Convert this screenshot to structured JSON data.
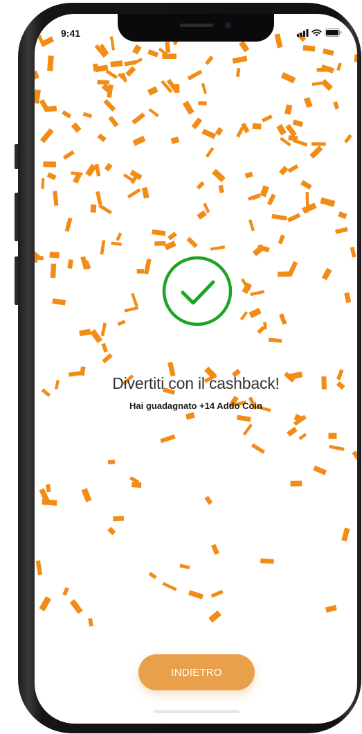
{
  "status_bar": {
    "time": "9:41",
    "icons": [
      "signal-icon",
      "wifi-icon",
      "battery-icon"
    ]
  },
  "success": {
    "icon": "checkmark-circle-icon",
    "title": "Divertiti con il cashback!",
    "subtitle": "Hai guadagnato +14 Addo Coin"
  },
  "actions": {
    "back_label": "INDIETRO"
  },
  "colors": {
    "accent": "#e9a04a",
    "confetti": "#f28c17",
    "success_green": "#1ea422"
  }
}
